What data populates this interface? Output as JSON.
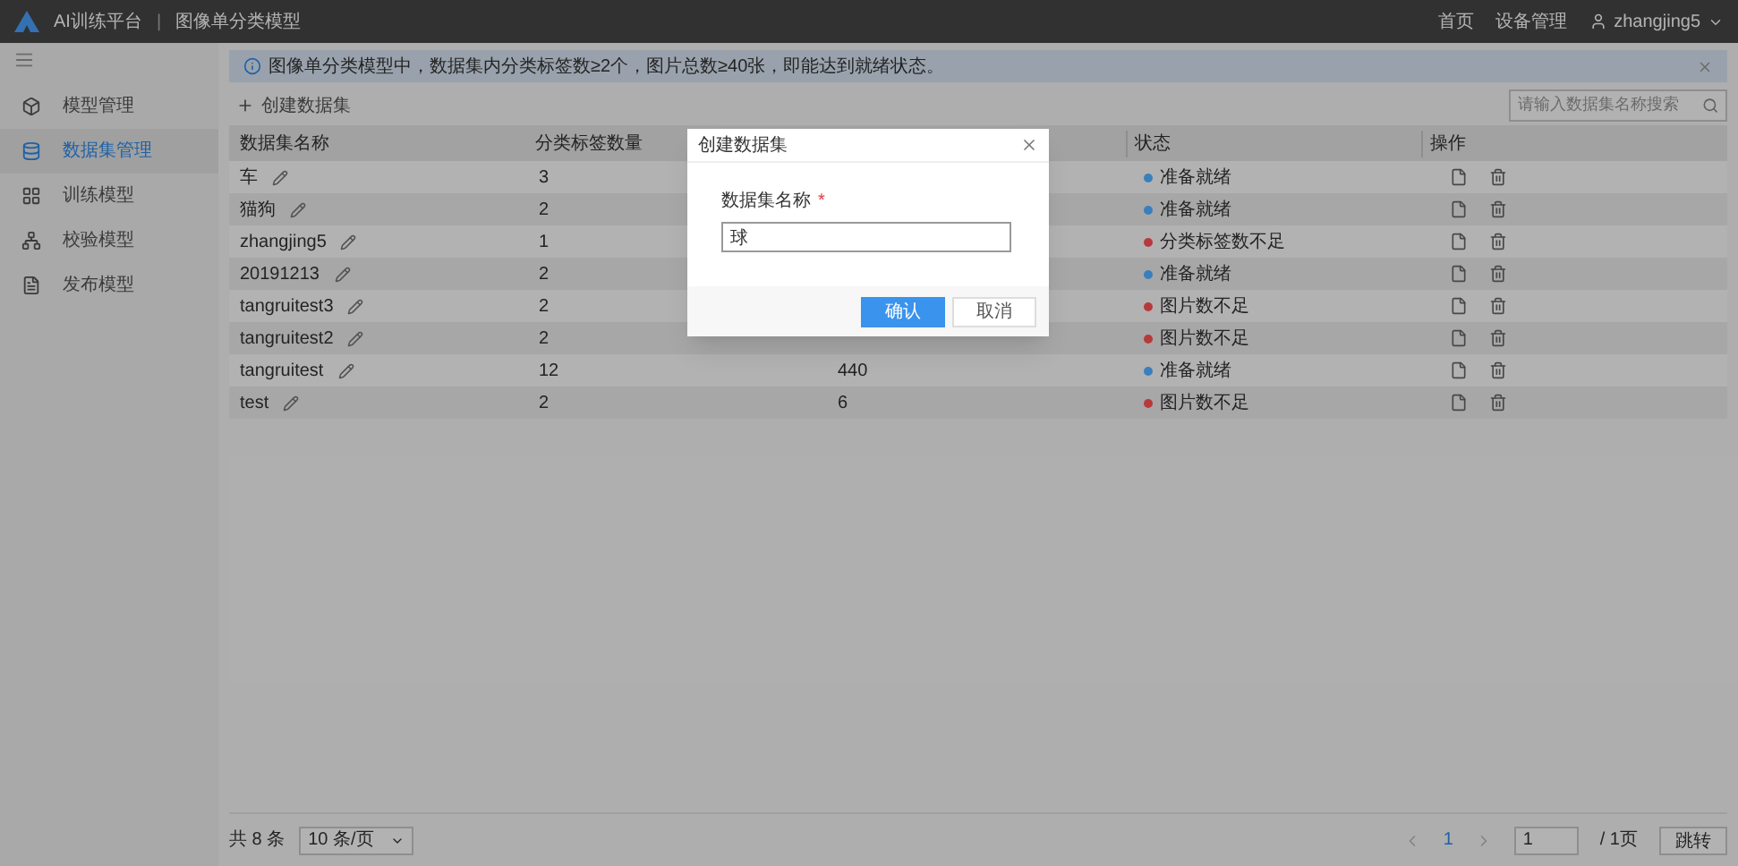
{
  "header": {
    "logo_text": "AI训练平台",
    "separator": "|",
    "page_title": "图像单分类模型",
    "nav": [
      "首页",
      "设备管理"
    ],
    "user": "zhangjing5"
  },
  "sidebar": {
    "items": [
      {
        "label": "模型管理",
        "selected": false
      },
      {
        "label": "数据集管理",
        "selected": true
      },
      {
        "label": "训练模型",
        "selected": false
      },
      {
        "label": "校验模型",
        "selected": false
      },
      {
        "label": "发布模型",
        "selected": false
      }
    ]
  },
  "alert": {
    "text": "图像单分类模型中，数据集内分类标签数≥2个，图片总数≥40张，即能达到就绪状态。"
  },
  "toolbar": {
    "create_label": "创建数据集",
    "search_placeholder": "请输入数据集名称搜索"
  },
  "table": {
    "columns": [
      "数据集名称",
      "分类标签数量",
      "状态",
      "操作"
    ],
    "rows": [
      {
        "name": "车",
        "labels": "3",
        "status": "准备就绪",
        "color": "#3a7fbd"
      },
      {
        "name": "猫狗",
        "labels": "2",
        "status": "准备就绪",
        "color": "#3a7fbd"
      },
      {
        "name": "zhangjing5",
        "labels": "1",
        "status": "分类标签数不足",
        "color": "#b8393c"
      },
      {
        "name": "20191213",
        "labels": "2",
        "status": "准备就绪",
        "color": "#3a7fbd"
      },
      {
        "name": "tangruitest3",
        "labels": "2",
        "status": "图片数不足",
        "color": "#b8393c"
      },
      {
        "name": "tangruitest2",
        "labels": "2",
        "status": "图片数不足",
        "color": "#b8393c"
      },
      {
        "name": "tangruitest",
        "labels": "12",
        "column_3": "440",
        "status": "准备就绪",
        "color": "#3a7fbd"
      },
      {
        "name": "test",
        "labels": "2",
        "column_3": "6",
        "status": "图片数不足",
        "color": "#b8393c"
      }
    ]
  },
  "pagination": {
    "total": "共 8 条",
    "page_size": "10 条/页",
    "pages": [
      {
        "label": "1",
        "selected": true
      }
    ],
    "jump_value": "1",
    "page_count": "/ 1页",
    "jump_label": "跳转"
  },
  "dialog": {
    "title": "创建数据集",
    "field_label": "数据集名称",
    "required_mark": "*",
    "field_value": "球",
    "buttons": [
      {
        "label": "确认",
        "kind": "primary"
      },
      {
        "label": "取消",
        "kind": "default"
      }
    ]
  }
}
